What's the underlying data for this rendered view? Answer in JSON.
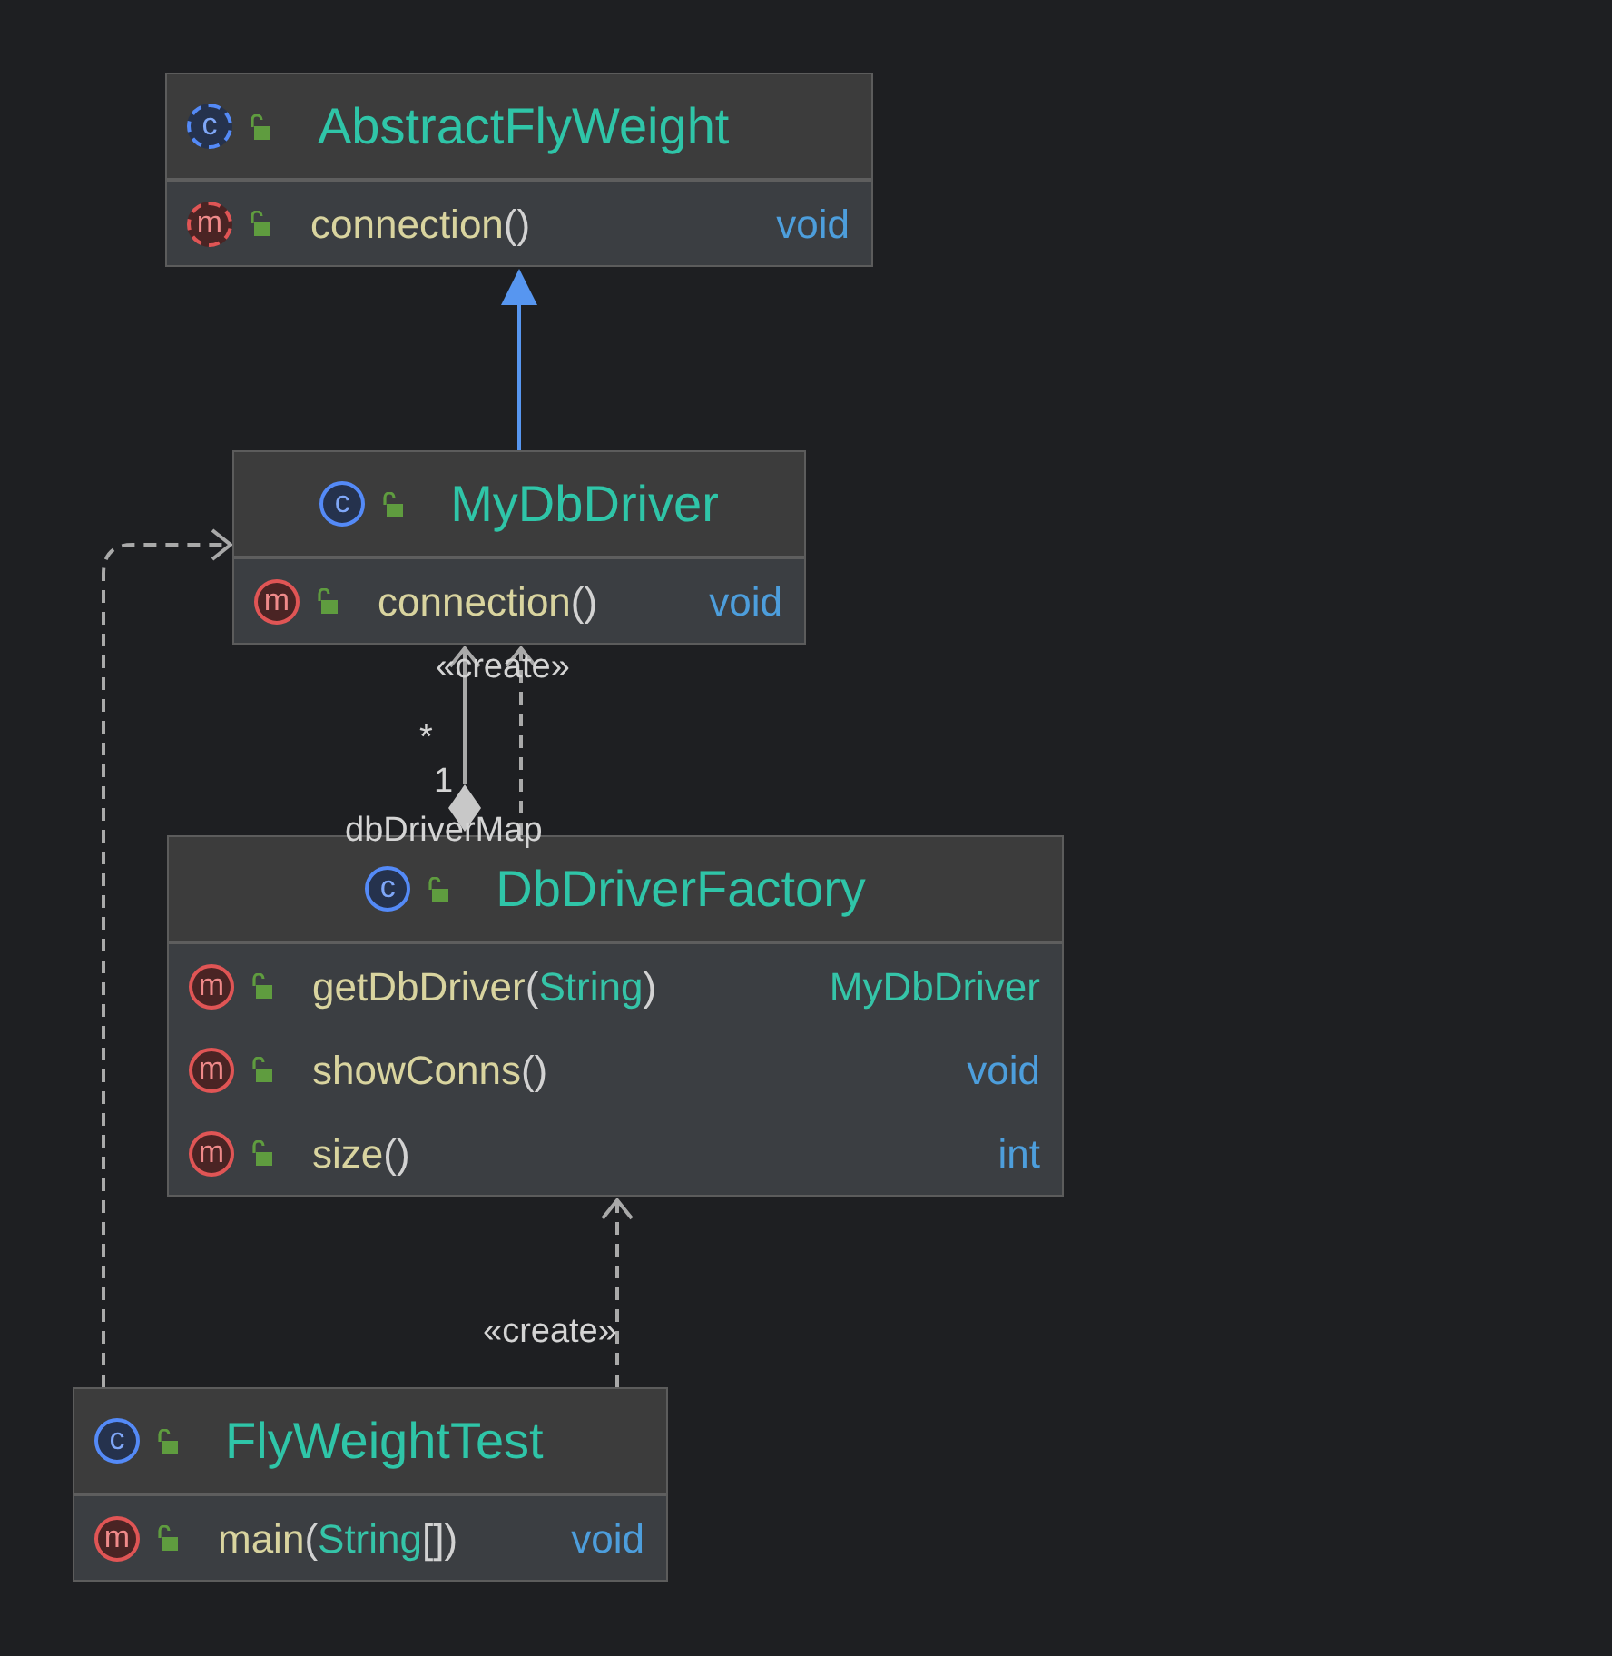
{
  "nodes": [
    {
      "kind": "class",
      "badge": "c",
      "abstract": true,
      "public": true,
      "name": "AbstractFlyWeight",
      "members": [
        {
          "kind": "method",
          "badge": "m",
          "abstract": true,
          "public": true,
          "signature": [
            {
              "text": "connection",
              "kind": "name"
            },
            {
              "text": "()",
              "kind": "punct"
            }
          ],
          "returns": {
            "text": "void",
            "kind": "keyword"
          }
        }
      ]
    },
    {
      "kind": "class",
      "badge": "c",
      "abstract": false,
      "public": true,
      "name": "MyDbDriver",
      "members": [
        {
          "kind": "method",
          "badge": "m",
          "abstract": false,
          "public": true,
          "signature": [
            {
              "text": "connection",
              "kind": "name"
            },
            {
              "text": "()",
              "kind": "punct"
            }
          ],
          "returns": {
            "text": "void",
            "kind": "keyword"
          }
        }
      ]
    },
    {
      "kind": "class",
      "badge": "c",
      "abstract": false,
      "public": true,
      "name": "DbDriverFactory",
      "members": [
        {
          "kind": "method",
          "badge": "m",
          "abstract": false,
          "public": true,
          "signature": [
            {
              "text": "getDbDriver",
              "kind": "name"
            },
            {
              "text": "(",
              "kind": "punct"
            },
            {
              "text": "String",
              "kind": "type"
            },
            {
              "text": ")",
              "kind": "punct"
            }
          ],
          "returns": {
            "text": "MyDbDriver",
            "kind": "type"
          }
        },
        {
          "kind": "method",
          "badge": "m",
          "abstract": false,
          "public": true,
          "signature": [
            {
              "text": "showConns",
              "kind": "name"
            },
            {
              "text": "()",
              "kind": "punct"
            }
          ],
          "returns": {
            "text": "void",
            "kind": "keyword"
          }
        },
        {
          "kind": "method",
          "badge": "m",
          "abstract": false,
          "public": true,
          "signature": [
            {
              "text": "size",
              "kind": "name"
            },
            {
              "text": "()",
              "kind": "punct"
            }
          ],
          "returns": {
            "text": "int",
            "kind": "keyword"
          }
        }
      ]
    },
    {
      "kind": "class",
      "badge": "c",
      "abstract": false,
      "public": true,
      "name": "FlyWeightTest",
      "members": [
        {
          "kind": "method",
          "badge": "m",
          "abstract": false,
          "public": true,
          "signature": [
            {
              "text": "main",
              "kind": "name"
            },
            {
              "text": "(",
              "kind": "punct"
            },
            {
              "text": "String",
              "kind": "type"
            },
            {
              "text": "[])",
              "kind": "punct"
            }
          ],
          "returns": {
            "text": "void",
            "kind": "keyword"
          }
        }
      ]
    }
  ],
  "edges": [
    {
      "kind": "inheritance"
    },
    {
      "kind": "dependency",
      "stereotype": "«create»"
    },
    {
      "kind": "aggregation",
      "target_multiplicity": "*",
      "source_multiplicity": "1",
      "role": "dbDriverMap"
    },
    {
      "kind": "dependency"
    },
    {
      "kind": "dependency",
      "stereotype": "«create»"
    }
  ]
}
